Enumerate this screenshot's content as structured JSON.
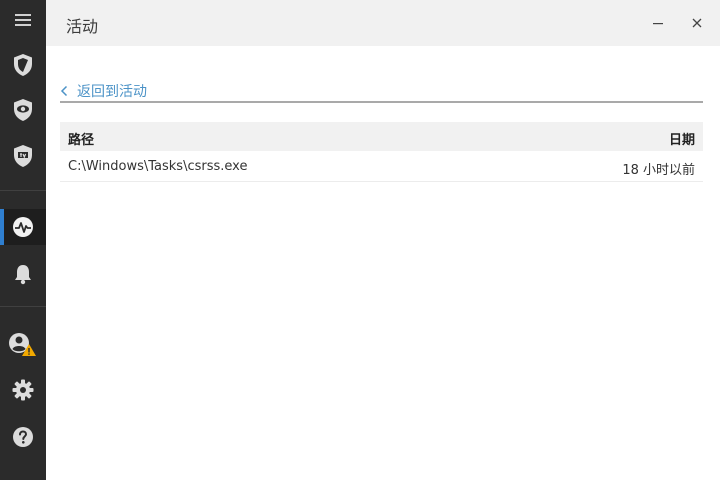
{
  "window": {
    "title": "活动"
  },
  "sidebar": {
    "items": [
      {
        "icon": "menu-icon"
      },
      {
        "icon": "shield-icon"
      },
      {
        "icon": "eye-shield-icon"
      },
      {
        "icon": "tv-shield-icon"
      },
      {
        "icon": "activity-icon",
        "active": true
      },
      {
        "icon": "bell-icon"
      },
      {
        "icon": "user-warning-icon"
      },
      {
        "icon": "gear-icon"
      },
      {
        "icon": "help-icon"
      }
    ]
  },
  "nav": {
    "back_label": "返回到活动"
  },
  "table": {
    "columns": {
      "path": "路径",
      "date": "日期"
    },
    "rows": [
      {
        "path": "C:\\Windows\\Tasks\\csrss.exe",
        "date": "18 小时以前"
      }
    ]
  },
  "colors": {
    "sidebar_bg": "#2b2b2b",
    "accent": "#2f7fd0",
    "link": "#4c93c7",
    "warning": "#f2a900"
  }
}
